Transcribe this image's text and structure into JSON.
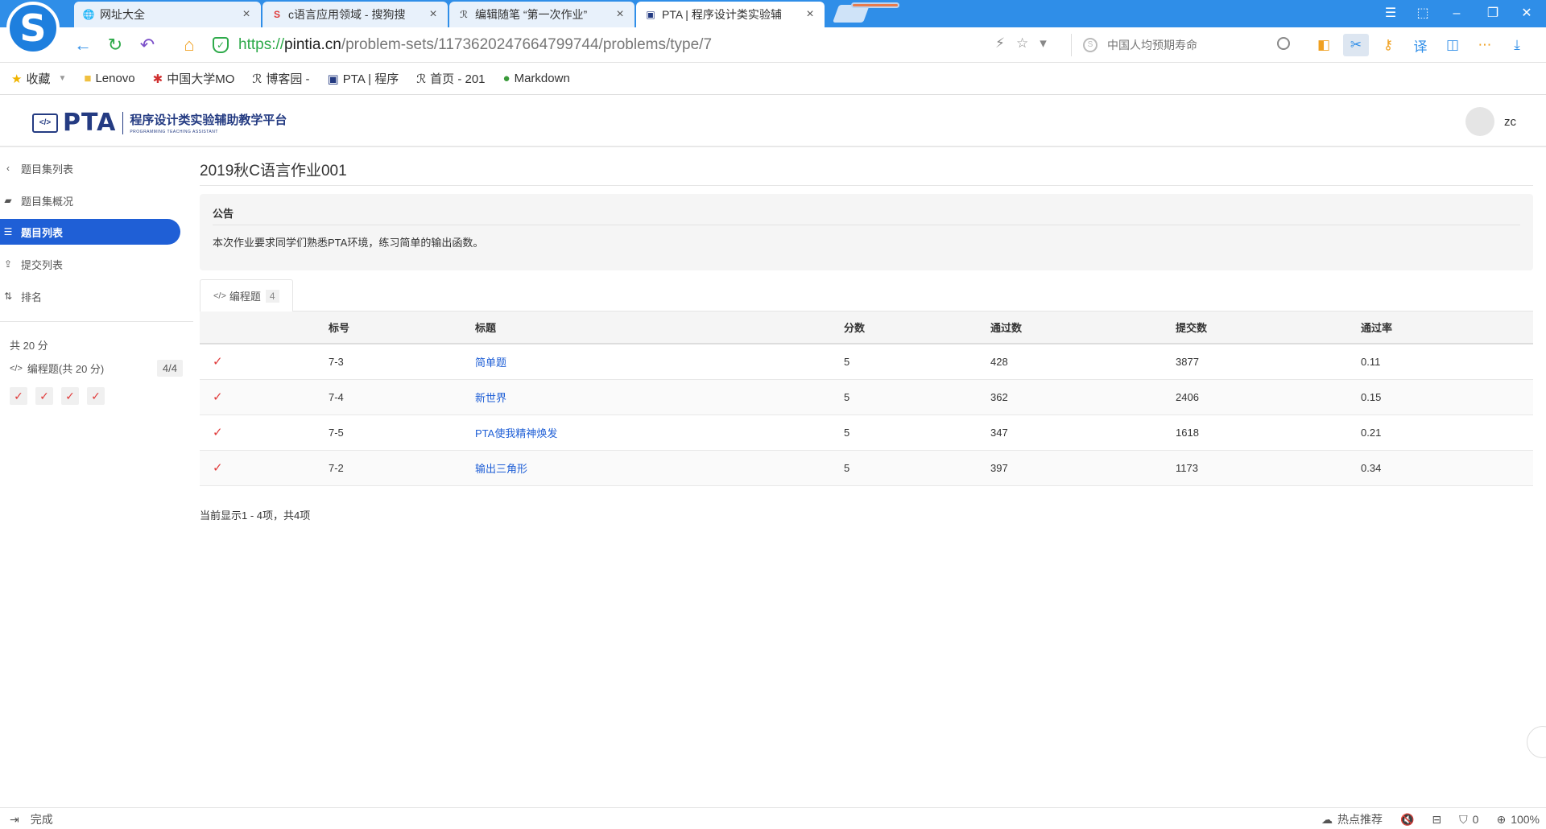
{
  "browser": {
    "tabs": [
      {
        "label": "网址大全",
        "icon": "globe-icon"
      },
      {
        "label": "c语言应用领域 - 搜狗搜",
        "icon": "sogou-icon"
      },
      {
        "label": "编辑随笔 “第一次作业”",
        "icon": "cnblogs-icon"
      },
      {
        "label": "PTA | 程序设计类实验辅",
        "icon": "pta-icon"
      }
    ],
    "active_tab": 3,
    "url": {
      "scheme": "https://",
      "host": "pintia.cn",
      "path": "/problem-sets/1173620247664799744/problems/type/7"
    },
    "search_placeholder": "中国人均预期寿命",
    "bookmarks": [
      {
        "label": "收藏",
        "icon": "star-icon"
      },
      {
        "label": "Lenovo",
        "icon": "folder-icon"
      },
      {
        "label": "中国大学MO",
        "icon": "mooc-icon"
      },
      {
        "label": "博客园 -",
        "icon": "cnblogs-icon"
      },
      {
        "label": "PTA | 程序",
        "icon": "pta-icon"
      },
      {
        "label": "首页 - 201",
        "icon": "cnblogs-icon"
      },
      {
        "label": "Markdown",
        "icon": "markdown-icon"
      }
    ],
    "status": {
      "left_text": "完成",
      "hot": "热点推荐",
      "ad_count": "0",
      "zoom": "100%"
    },
    "accent_color": "#2f8ee8"
  },
  "site": {
    "logo_word": "PTA",
    "logo_cn": "程序设计类实验辅助教学平台",
    "logo_en": "PROGRAMMING TEACHING ASSISTANT",
    "user": "zc"
  },
  "sidebar": {
    "back": "题目集列表",
    "items": [
      {
        "label": "题目集概况",
        "icon": "book-icon"
      },
      {
        "label": "题目列表",
        "icon": "list-icon"
      },
      {
        "label": "提交列表",
        "icon": "upload-icon"
      },
      {
        "label": "排名",
        "icon": "sort-icon"
      }
    ],
    "active": 1,
    "total": "共 20 分",
    "category": "编程题(共 20 分)",
    "category_progress": "4/4",
    "checks": [
      "✓",
      "✓",
      "✓",
      "✓"
    ],
    "active_color": "#1f5fd6"
  },
  "main": {
    "title": "2019秋C语言作业001",
    "notice_head": "公告",
    "notice_body": "本次作业要求同学们熟悉PTA环境，练习简单的输出函数。",
    "tab_label": "编程题",
    "tab_count": "4",
    "table": {
      "headers": [
        "",
        "标号",
        "标题",
        "分数",
        "通过数",
        "提交数",
        "通过率"
      ],
      "rows": [
        {
          "status": "✓",
          "id": "7-3",
          "title": "简单题",
          "score": "5",
          "passed": "428",
          "submitted": "3877",
          "rate": "0.11"
        },
        {
          "status": "✓",
          "id": "7-4",
          "title": "新世界",
          "score": "5",
          "passed": "362",
          "submitted": "2406",
          "rate": "0.15"
        },
        {
          "status": "✓",
          "id": "7-5",
          "title": "PTA使我精神焕发",
          "score": "5",
          "passed": "347",
          "submitted": "1618",
          "rate": "0.21"
        },
        {
          "status": "✓",
          "id": "7-2",
          "title": "输出三角形",
          "score": "5",
          "passed": "397",
          "submitted": "1173",
          "rate": "0.34"
        }
      ]
    },
    "pager": "当前显示1 - 4项，共4项"
  }
}
